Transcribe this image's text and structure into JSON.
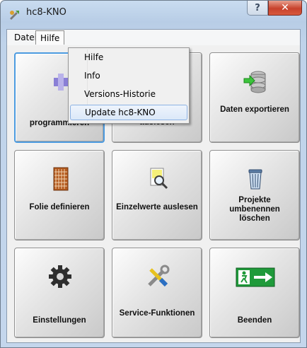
{
  "window": {
    "title": "hc8-KNO",
    "help_label": "?",
    "close_label": "✕"
  },
  "menubar": {
    "items": [
      {
        "label": "Datei"
      },
      {
        "label": "Hilfe"
      }
    ]
  },
  "dropdown": {
    "items": [
      {
        "label": "Hilfe"
      },
      {
        "label": "Info"
      },
      {
        "label": "Versions-Historie"
      },
      {
        "label": "Update hc8-KNO"
      }
    ]
  },
  "tiles": [
    {
      "label": "programmieren",
      "icon": "program-icon"
    },
    {
      "label": "auslesen",
      "icon": "read-icon"
    },
    {
      "label": "Daten exportieren",
      "icon": "database-export-icon"
    },
    {
      "label": "Folie definieren",
      "icon": "foil-icon"
    },
    {
      "label": "Einzelwerte auslesen",
      "icon": "document-magnifier-icon"
    },
    {
      "label": "Projekte umbenennen löschen",
      "icon": "trash-icon"
    },
    {
      "label": "Einstellungen",
      "icon": "gear-icon"
    },
    {
      "label": "Service-Funktionen",
      "icon": "tools-icon"
    },
    {
      "label": "Beenden",
      "icon": "exit-sign-icon"
    }
  ],
  "colors": {
    "accent": "#4c9be0",
    "exit_green": "#1f9a3a",
    "close_red": "#c7422c"
  }
}
